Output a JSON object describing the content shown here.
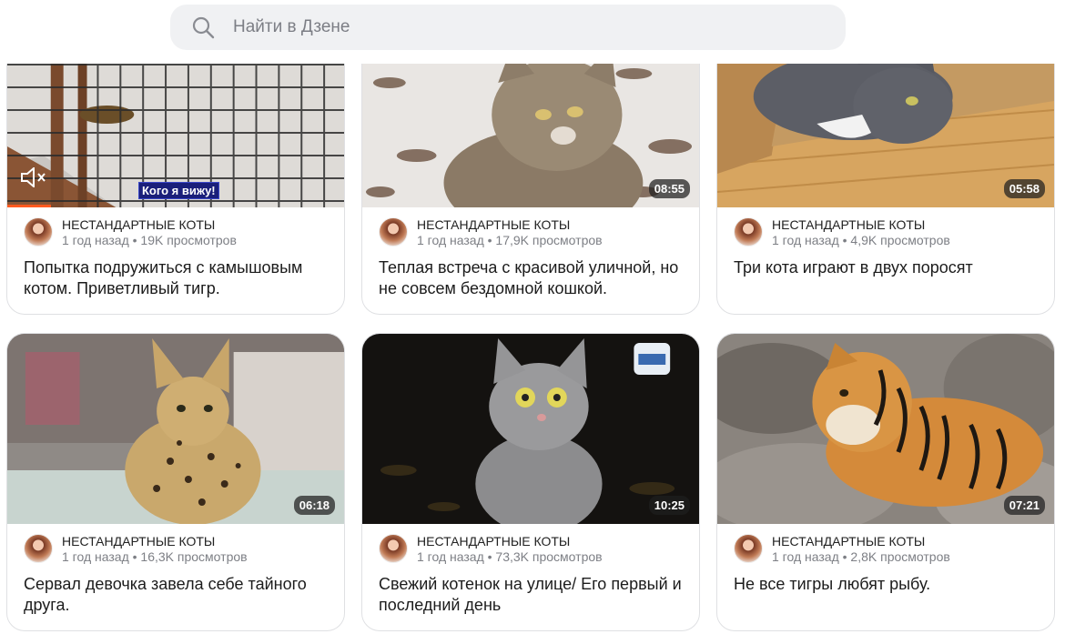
{
  "search": {
    "placeholder": "Найти в Дзене"
  },
  "cards": [
    {
      "channel": "НЕСТАНДАРТНЫЕ КОТЫ",
      "stats": "1 год назад • 19K просмотров",
      "title": "Попытка подружиться с камышовым котом. Приветливый тигр.",
      "subtitle": "Кого я вижу!",
      "progress": 0.13
    },
    {
      "channel": "НЕСТАНДАРТНЫЕ КОТЫ",
      "stats": "1 год назад • 17,9K просмотров",
      "title": "Теплая встреча с красивой уличной, но не совсем бездомной кошкой.",
      "duration": "08:55"
    },
    {
      "channel": "НЕСТАНДАРТНЫЕ КОТЫ",
      "stats": "1 год назад • 4,9K просмотров",
      "title": "Три кота играют в двух поросят",
      "duration": "05:58"
    },
    {
      "channel": "НЕСТАНДАРТНЫЕ КОТЫ",
      "stats": "1 год назад • 16,3K просмотров",
      "title": "Сервал девочка завела себе тайного друга.",
      "duration": "06:18"
    },
    {
      "channel": "НЕСТАНДАРТНЫЕ КОТЫ",
      "stats": "1 год назад • 73,3K просмотров",
      "title": "Свежий котенок на улице/ Его первый и последний день",
      "duration": "10:25"
    },
    {
      "channel": "НЕСТАНДАРТНЫЕ КОТЫ",
      "stats": "1 год назад • 2,8K просмотров",
      "title": "Не все тигры любят рыбу.",
      "duration": "07:21"
    }
  ],
  "icons": {
    "search": "search-icon",
    "mute": "mute-icon"
  },
  "colors": {
    "accent": "#ff5a1f",
    "search_bg": "#f0f1f3",
    "card_border": "#dfe0e3"
  }
}
